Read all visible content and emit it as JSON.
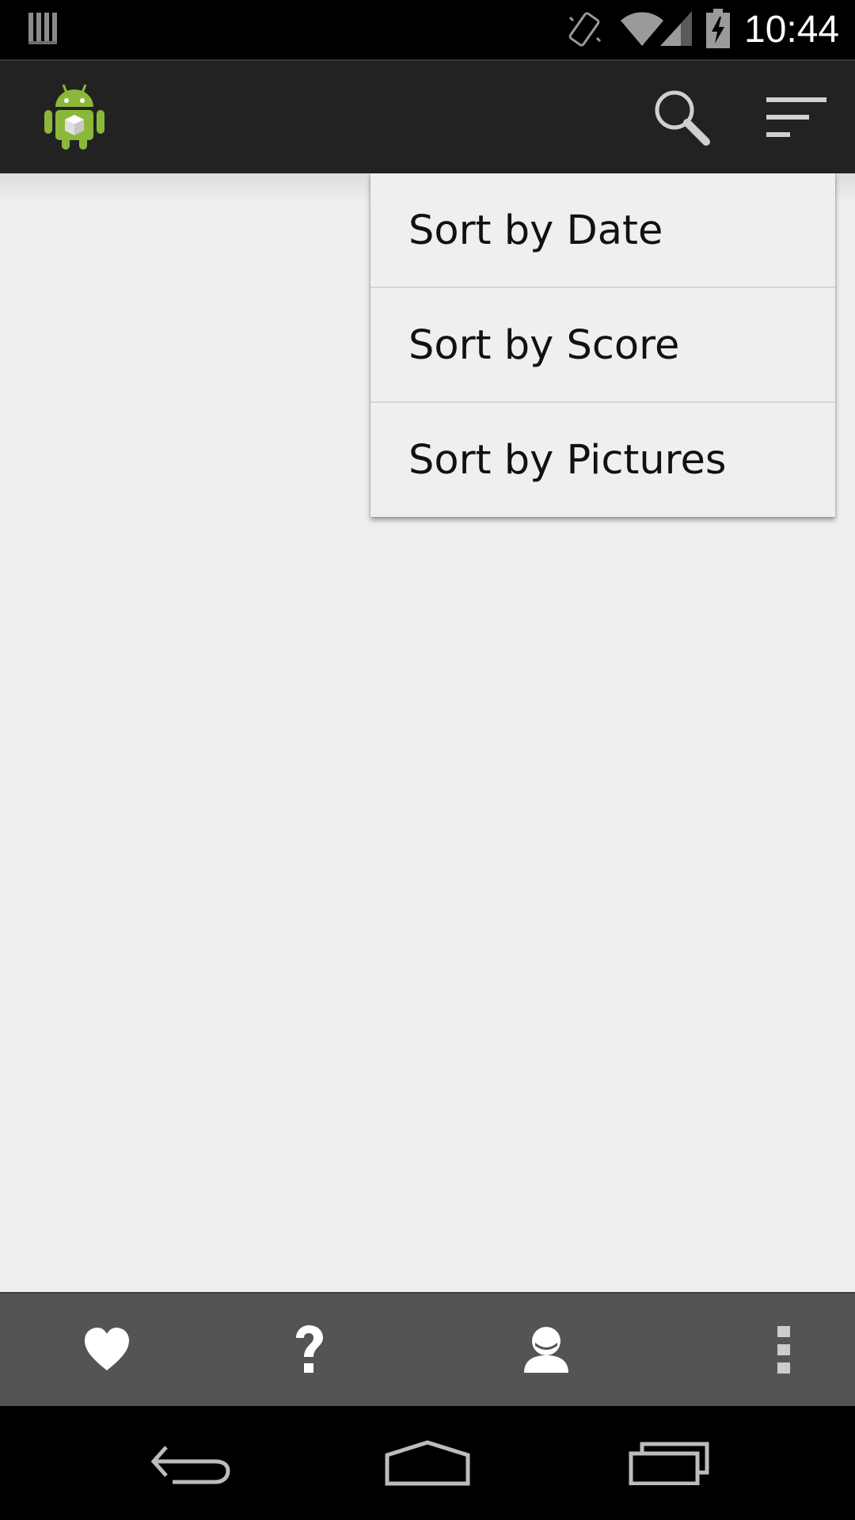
{
  "status_bar": {
    "time": "10:44",
    "icons": [
      "notification-icon",
      "vibrate-icon",
      "wifi-icon",
      "signal-icon",
      "battery-charging-icon"
    ]
  },
  "action_bar": {
    "app_icon": "android-app-icon",
    "actions": [
      "search-icon",
      "sort-icon"
    ],
    "background": "#222222"
  },
  "sort_menu": {
    "items": [
      {
        "label": "Sort by Date"
      },
      {
        "label": "Sort by Score"
      },
      {
        "label": "Sort by Pictures"
      }
    ]
  },
  "bottom_bar": {
    "items": [
      "heart-icon",
      "question-icon",
      "profile-icon",
      "overflow-menu-icon"
    ],
    "background": "#545454"
  },
  "nav_bar": {
    "items": [
      "back-icon",
      "home-icon",
      "recents-icon"
    ]
  },
  "colors": {
    "content_bg": "#eeeeee",
    "android_green": "#8cb83a"
  }
}
